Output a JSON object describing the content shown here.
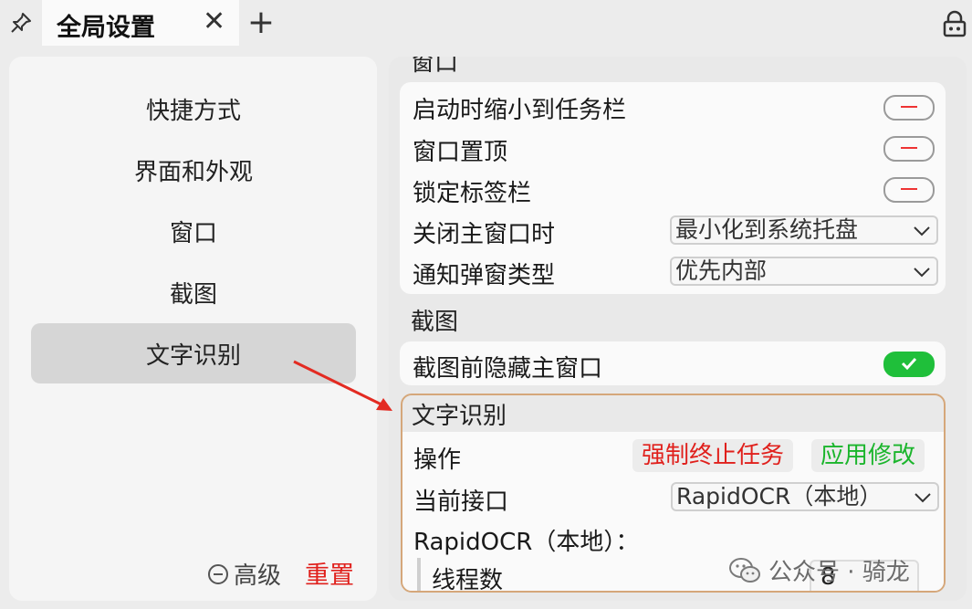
{
  "tabbar": {
    "tab_title": "全局设置",
    "close_glyph": "✕",
    "add_glyph": "+",
    "pin_icon": "pin-icon",
    "lock_icon": "lock-icon"
  },
  "sidebar": {
    "items": [
      {
        "label": "快捷方式",
        "active": false
      },
      {
        "label": "界面和外观",
        "active": false
      },
      {
        "label": "窗口",
        "active": false
      },
      {
        "label": "截图",
        "active": false
      },
      {
        "label": "文字识别",
        "active": true
      }
    ],
    "advanced_label": "高级",
    "reset_label": "重置"
  },
  "main": {
    "window_section": {
      "title": "窗口",
      "rows": {
        "minimize_on_start": "启动时缩小到任务栏",
        "always_on_top": "窗口置顶",
        "lock_tabbar": "锁定标签栏",
        "close_main": "关闭主窗口时",
        "notify_type": "通知弹窗类型"
      },
      "close_main_value": "最小化到系统托盘",
      "notify_type_value": "优先内部"
    },
    "screenshot_section": {
      "title": "截图",
      "hide_main_label": "截图前隐藏主窗口",
      "hide_main_on": true
    },
    "ocr_section": {
      "title": "文字识别",
      "operation_label": "操作",
      "force_stop_label": "强制终止任务",
      "apply_label": "应用修改",
      "current_api_label": "当前接口",
      "current_api_value": "RapidOCR（本地）",
      "engine_heading": "RapidOCR（本地）：",
      "threads_label": "线程数",
      "threads_value": "8"
    }
  },
  "watermark": {
    "text": "公众号 · 骑龙",
    "icon": "wechat-icon"
  },
  "colors": {
    "accent_red": "#e0201c",
    "accent_green": "#1bb52c",
    "highlight_border": "#d5a77a",
    "toggle_on": "#1fbf3a"
  }
}
